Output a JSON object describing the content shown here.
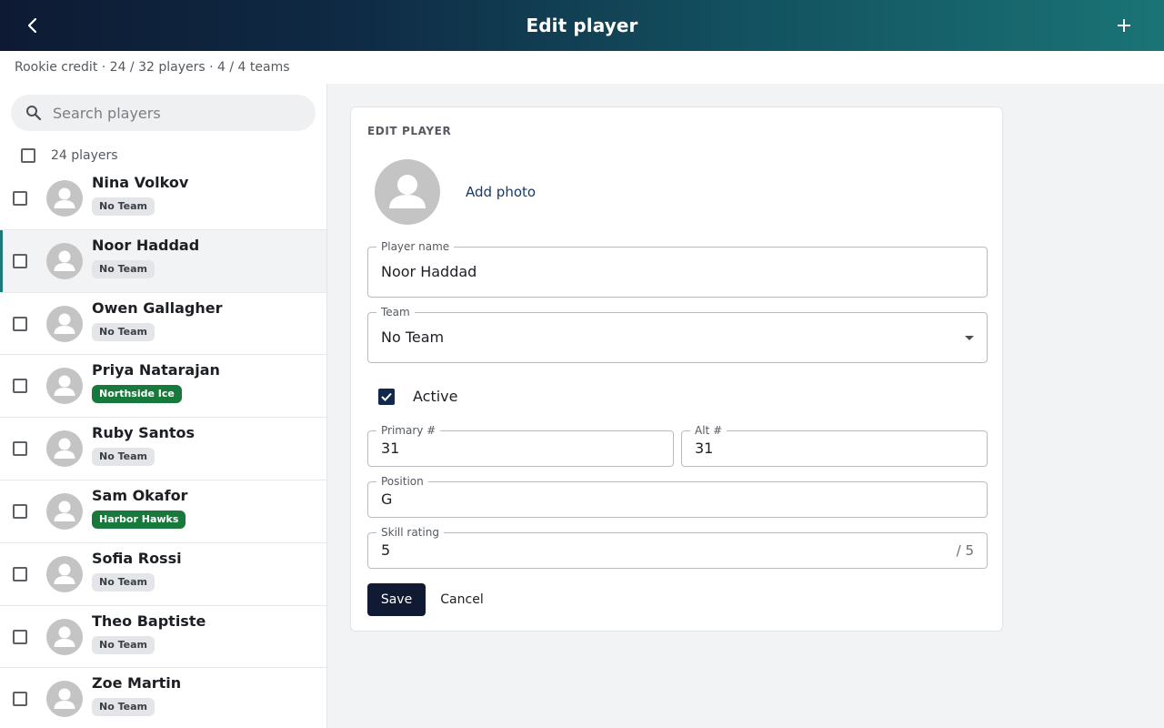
{
  "app_bar": {
    "title": "Edit player",
    "back_icon": "chevron-left-icon",
    "add_icon": "plus-icon"
  },
  "subheader": {
    "text": "Rookie credit · 24 / 32 players · 4 / 4 teams"
  },
  "sidebar": {
    "search_placeholder": "Search players",
    "count_label": "24 players",
    "players": [
      {
        "name": "Nina Volkov",
        "team": "No Team",
        "has_team": false,
        "selected": false
      },
      {
        "name": "Noor Haddad",
        "team": "No Team",
        "has_team": false,
        "selected": true
      },
      {
        "name": "Owen Gallagher",
        "team": "No Team",
        "has_team": false,
        "selected": false
      },
      {
        "name": "Priya Natarajan",
        "team": "Northside Ice",
        "has_team": true,
        "selected": false
      },
      {
        "name": "Ruby Santos",
        "team": "No Team",
        "has_team": false,
        "selected": false
      },
      {
        "name": "Sam Okafor",
        "team": "Harbor Hawks",
        "has_team": true,
        "selected": false
      },
      {
        "name": "Sofia Rossi",
        "team": "No Team",
        "has_team": false,
        "selected": false
      },
      {
        "name": "Theo Baptiste",
        "team": "No Team",
        "has_team": false,
        "selected": false
      },
      {
        "name": "Zoe Martin",
        "team": "No Team",
        "has_team": false,
        "selected": false
      }
    ]
  },
  "form": {
    "heading": "EDIT PLAYER",
    "add_photo": "Add photo",
    "name_label": "Player name",
    "name_value": "Noor Haddad",
    "team_label": "Team",
    "team_value": "No Team",
    "active_label": "Active",
    "active_checked": true,
    "primary_label": "Primary #",
    "primary_value": "31",
    "alt_label": "Alt #",
    "alt_value": "31",
    "position_label": "Position",
    "position_value": "G",
    "skill_label": "Skill rating",
    "skill_value": "5",
    "skill_suffix": "/ 5",
    "save_label": "Save",
    "cancel_label": "Cancel"
  },
  "colors": {
    "accent": "#1d7a78",
    "primary_dark": "#111a33",
    "team_chip": "#177a3c"
  }
}
